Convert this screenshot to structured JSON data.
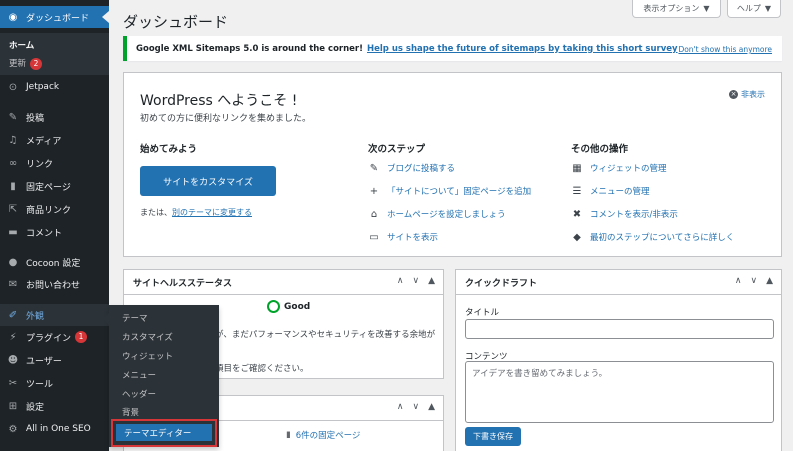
{
  "sidebar": {
    "dashboard": "ダッシュボード",
    "home": "ホーム",
    "updates": "更新",
    "updates_count": "2",
    "jetpack": "Jetpack",
    "posts": "投稿",
    "media": "メディア",
    "links": "リンク",
    "pages": "固定ページ",
    "product_links": "商品リンク",
    "comments": "コメント",
    "cocoon": "Cocoon 設定",
    "contact": "お問い合わせ",
    "appearance": "外観",
    "plugins": "プラグイン",
    "plugins_count": "1",
    "users": "ユーザー",
    "tools": "ツール",
    "settings": "設定",
    "aioseo": "All in One SEO"
  },
  "flyout": {
    "themes": "テーマ",
    "customize": "カスタマイズ",
    "widgets": "ウィジェット",
    "menus": "メニュー",
    "header": "ヘッダー",
    "background": "背景",
    "theme_editor": "テーマエディター"
  },
  "header": {
    "title": "ダッシュボード",
    "screen_options": "表示オプション",
    "help": "ヘルプ"
  },
  "notice": {
    "text": "Google XML Sitemaps 5.0 is around the corner!",
    "link": "Help us shape the future of sitemaps by taking this short survey",
    "dismiss": "Don't show this anymore"
  },
  "welcome": {
    "title": "WordPress へようこそ !",
    "lead": "初めての方に便利なリンクを集めました。",
    "hide": "非表示",
    "get_started": "始めてみよう",
    "customize_button": "サイトをカスタマイズ",
    "or_prefix": "または、",
    "change_theme": "別のテーマに変更する",
    "next_steps": "次のステップ",
    "next": [
      "ブログに投稿する",
      "「サイトについて」固定ページを追加",
      "ホームページを設定しましょう",
      "サイトを表示"
    ],
    "more_actions": "その他の操作",
    "more": [
      "ウィジェットの管理",
      "メニューの管理",
      "コメントを表示/非表示",
      "最初のステップについてさらに詳しく"
    ]
  },
  "site_health": {
    "title": "サイトヘルスステータス",
    "status": "Good",
    "line1": "が、まだパフォーマンスやセキュリティを改善する余地が",
    "line2": "項目をご確認ください。"
  },
  "at_a_glance": {
    "pages_count": "6件の固定ページ"
  },
  "quick_draft": {
    "title": "クイックドラフト",
    "title_label": "タイトル",
    "content_label": "コンテンツ",
    "content_placeholder": "アイデアを書き留めてみましょう。",
    "save_button": "下書き保存"
  },
  "colors": {
    "sidebar_bg": "#1d2327",
    "accent": "#2271b1",
    "badge": "#d63638",
    "notice_border": "#00a32a",
    "highlight_box": "#d63638"
  }
}
